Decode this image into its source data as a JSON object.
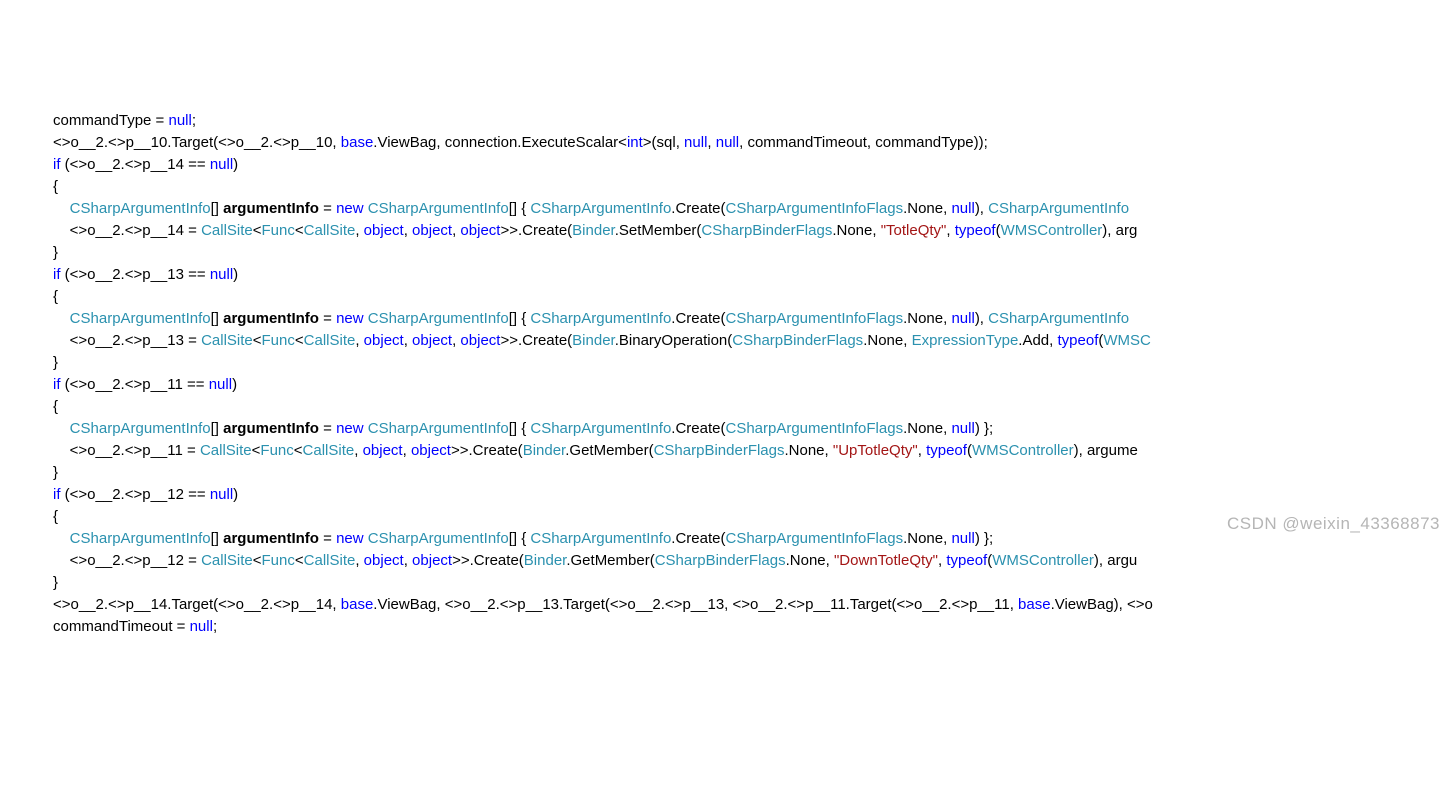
{
  "lines": {
    "l01a": "commandType = ",
    "l01b": "null",
    "l01c": ";",
    "l02a": "<>o__2.<>p__10.Target(<>o__2.<>p__10, ",
    "l02b": "base",
    "l02c": ".ViewBag, connection.ExecuteScalar<",
    "l02d": "int",
    "l02e": ">(sql, ",
    "l02f": "null",
    "l02g": ", ",
    "l02h": "null",
    "l02i": ", commandTimeout, commandType));",
    "l03a": "if",
    "l03b": " (<>o__2.<>p__14 == ",
    "l03c": "null",
    "l03d": ")",
    "l04": "{",
    "l05a": "CSharpArgumentInfo",
    "l05b": "[] ",
    "l05c": "argumentInfo",
    "l05d": " = ",
    "l05e": "new",
    "l05f": " ",
    "l05g": "CSharpArgumentInfo",
    "l05h": "[] { ",
    "l05i": "CSharpArgumentInfo",
    "l05j": ".Create(",
    "l05k": "CSharpArgumentInfoFlags",
    "l05l": ".None, ",
    "l05m": "null",
    "l05n": "), ",
    "l05o": "CSharpArgumentInfo",
    "l06a": "<>o__2.<>p__14 = ",
    "l06b": "CallSite",
    "l06c": "<",
    "l06d": "Func",
    "l06e": "<",
    "l06f": "CallSite",
    "l06g": ", ",
    "l06h": "object",
    "l06i": ", ",
    "l06j": "object",
    "l06k": ", ",
    "l06l": "object",
    "l06m": ">>.Create(",
    "l06n": "Binder",
    "l06o": ".SetMember(",
    "l06p": "CSharpBinderFlags",
    "l06q": ".None, ",
    "l06r": "\"TotleQty\"",
    "l06s": ", ",
    "l06t": "typeof",
    "l06u": "(",
    "l06v": "WMSController",
    "l06w": "), arg",
    "l07": "}",
    "l08a": "if",
    "l08b": " (<>o__2.<>p__13 == ",
    "l08c": "null",
    "l08d": ")",
    "l09": "{",
    "l10a": "CSharpArgumentInfo",
    "l10b": "[] ",
    "l10c": "argumentInfo",
    "l10d": " = ",
    "l10e": "new",
    "l10f": " ",
    "l10g": "CSharpArgumentInfo",
    "l10h": "[] { ",
    "l10i": "CSharpArgumentInfo",
    "l10j": ".Create(",
    "l10k": "CSharpArgumentInfoFlags",
    "l10l": ".None, ",
    "l10m": "null",
    "l10n": "), ",
    "l10o": "CSharpArgumentInfo",
    "l11a": "<>o__2.<>p__13 = ",
    "l11b": "CallSite",
    "l11c": "<",
    "l11d": "Func",
    "l11e": "<",
    "l11f": "CallSite",
    "l11g": ", ",
    "l11h": "object",
    "l11i": ", ",
    "l11j": "object",
    "l11k": ", ",
    "l11l": "object",
    "l11m": ">>.Create(",
    "l11n": "Binder",
    "l11o": ".BinaryOperation(",
    "l11p": "CSharpBinderFlags",
    "l11q": ".None, ",
    "l11r": "ExpressionType",
    "l11s": ".Add, ",
    "l11t": "typeof",
    "l11u": "(",
    "l11v": "WMSC",
    "l12": "}",
    "l13a": "if",
    "l13b": " (<>o__2.<>p__11 == ",
    "l13c": "null",
    "l13d": ")",
    "l14": "{",
    "l15a": "CSharpArgumentInfo",
    "l15b": "[] ",
    "l15c": "argumentInfo",
    "l15d": " = ",
    "l15e": "new",
    "l15f": " ",
    "l15g": "CSharpArgumentInfo",
    "l15h": "[] { ",
    "l15i": "CSharpArgumentInfo",
    "l15j": ".Create(",
    "l15k": "CSharpArgumentInfoFlags",
    "l15l": ".None, ",
    "l15m": "null",
    "l15n": ") };",
    "l16a": "<>o__2.<>p__11 = ",
    "l16b": "CallSite",
    "l16c": "<",
    "l16d": "Func",
    "l16e": "<",
    "l16f": "CallSite",
    "l16g": ", ",
    "l16h": "object",
    "l16i": ", ",
    "l16j": "object",
    "l16k": ">>.Create(",
    "l16l": "Binder",
    "l16m": ".GetMember(",
    "l16n": "CSharpBinderFlags",
    "l16o": ".None, ",
    "l16p": "\"UpTotleQty\"",
    "l16q": ", ",
    "l16r": "typeof",
    "l16s": "(",
    "l16t": "WMSController",
    "l16u": "), argume",
    "l17": "}",
    "l18a": "if",
    "l18b": " (<>o__2.<>p__12 == ",
    "l18c": "null",
    "l18d": ")",
    "l19": "{",
    "l20a": "CSharpArgumentInfo",
    "l20b": "[] ",
    "l20c": "argumentInfo",
    "l20d": " = ",
    "l20e": "new",
    "l20f": " ",
    "l20g": "CSharpArgumentInfo",
    "l20h": "[] { ",
    "l20i": "CSharpArgumentInfo",
    "l20j": ".Create(",
    "l20k": "CSharpArgumentInfoFlags",
    "l20l": ".None, ",
    "l20m": "null",
    "l20n": ") };",
    "l21a": "<>o__2.<>p__12 = ",
    "l21b": "CallSite",
    "l21c": "<",
    "l21d": "Func",
    "l21e": "<",
    "l21f": "CallSite",
    "l21g": ", ",
    "l21h": "object",
    "l21i": ", ",
    "l21j": "object",
    "l21k": ">>.Create(",
    "l21l": "Binder",
    "l21m": ".GetMember(",
    "l21n": "CSharpBinderFlags",
    "l21o": ".None, ",
    "l21p": "\"DownTotleQty\"",
    "l21q": ", ",
    "l21r": "typeof",
    "l21s": "(",
    "l21t": "WMSController",
    "l21u": "), argu",
    "l22": "}",
    "l23a": "<>o__2.<>p__14.Target(<>o__2.<>p__14, ",
    "l23b": "base",
    "l23c": ".ViewBag, <>o__2.<>p__13.Target(<>o__2.<>p__13, <>o__2.<>p__11.Target(<>o__2.<>p__11, ",
    "l23d": "base",
    "l23e": ".ViewBag), <>o",
    "l24a": "commandTimeout = ",
    "l24b": "null",
    "l24c": ";"
  },
  "watermark": "CSDN @weixin_43368873"
}
